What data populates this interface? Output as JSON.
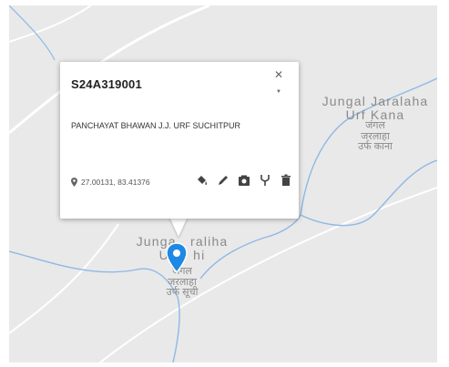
{
  "popup": {
    "title": "S24A319001",
    "address": "PANCHAYAT BHAWAN J.J. URF SUCHITPUR",
    "coordinates": "27.00131, 83.41376",
    "close_glyph": "✕",
    "collapse_glyph": "▼",
    "icons": [
      "paint-bucket-icon",
      "pencil-icon",
      "camera-icon",
      "fork-icon",
      "trash-icon"
    ]
  },
  "places": [
    {
      "name_en_1": "Jungal Jaralaha",
      "name_en_2": "Urf Kana",
      "name_hi_1": "जंगल",
      "name_hi_2": "जरलाहा",
      "name_hi_3": "उर्फ काना"
    },
    {
      "name_en_1": "Junga   raliha",
      "name_en_2": "Urf   hi",
      "name_hi_1": "जंगल",
      "name_hi_2": "जरलाहा",
      "name_hi_3": "उर्फ सूची"
    }
  ],
  "colors": {
    "map_bg": "#e9e9e9",
    "river": "#8fb8e6",
    "road": "#ffffff",
    "marker": "#1e88e5"
  }
}
